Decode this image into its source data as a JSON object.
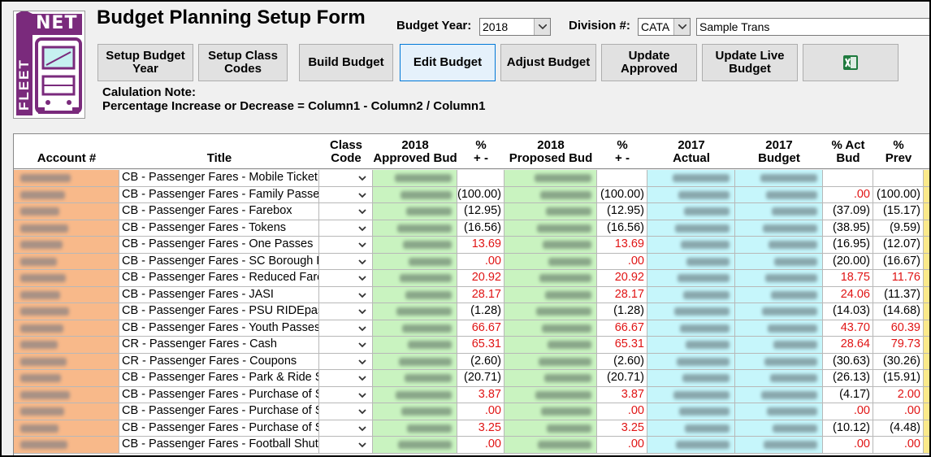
{
  "window": {
    "title": "Budget Planning Setup Form",
    "budget_year_label": "Budget Year:",
    "budget_year_value": "2018",
    "division_label": "Division #:",
    "division_value": "CATA",
    "division_name": "Sample Trans"
  },
  "logo": {
    "top_text": "NET",
    "side_text": "FLEET"
  },
  "toolbar": {
    "setup_budget_year": "Setup Budget Year",
    "setup_class_codes": "Setup Class Codes",
    "build_budget": "Build Budget",
    "edit_budget": "Edit Budget",
    "adjust_budget": "Adjust Budget",
    "update_approved": "Update Approved",
    "update_live_budget": "Update Live Budget",
    "excel_icon": "excel-icon"
  },
  "note": {
    "line1": "Calulation Note:",
    "line2": "Percentage Increase or Decrease =  Column1 - Column2 / Column1"
  },
  "columns": {
    "account": "Account #",
    "title": "Title",
    "class_code": "Class\nCode",
    "approved": "2018\nApproved Bud",
    "pct1": "%\n+ -",
    "proposed": "2018\nProposed Bud",
    "pct2": "%\n+ -",
    "actual": "2017\nActual",
    "budget": "2017\nBudget",
    "pct_act": "% Act\nBud",
    "pct_prev": "%\nPrev"
  },
  "colors": {
    "account_bg": "#f8b98a",
    "approved_bg": "#c9f3c0",
    "actual_bg": "#c6f6fb",
    "negative_text": "#000000",
    "positive_text": "#e01414"
  },
  "rows": [
    {
      "title": "CB - Passenger Fares - Mobile Ticketing",
      "pct1": "",
      "pct2": "",
      "pct_act": "",
      "pct_prev": ""
    },
    {
      "title": "CB - Passenger Fares - Family Passes",
      "pct1": "(100.00)",
      "pct2": "(100.00)",
      "pct_act": ".00",
      "pct_prev": "(100.00)"
    },
    {
      "title": "CB - Passenger Fares - Farebox",
      "pct1": "(12.95)",
      "pct2": "(12.95)",
      "pct_act": "(37.09)",
      "pct_prev": "(15.17)"
    },
    {
      "title": "CB - Passenger Fares - Tokens",
      "pct1": "(16.56)",
      "pct2": "(16.56)",
      "pct_act": "(38.95)",
      "pct_prev": "(9.59)"
    },
    {
      "title": "CB - Passenger Fares - One Passes",
      "pct1": "13.69",
      "pct2": "13.69",
      "pct_act": "(16.95)",
      "pct_prev": "(12.07)"
    },
    {
      "title": "CB - Passenger Fares - SC Borough Pas",
      "pct1": ".00",
      "pct2": ".00",
      "pct_act": "(20.00)",
      "pct_prev": "(16.67)"
    },
    {
      "title": "CB - Passenger Fares - Reduced Fare",
      "pct1": "20.92",
      "pct2": "20.92",
      "pct_act": "18.75",
      "pct_prev": "11.76"
    },
    {
      "title": "CB - Passenger Fares - JASI",
      "pct1": "28.17",
      "pct2": "28.17",
      "pct_act": "24.06",
      "pct_prev": "(11.37)"
    },
    {
      "title": "CB - Passenger Fares - PSU RIDEpass",
      "pct1": "(1.28)",
      "pct2": "(1.28)",
      "pct_act": "(14.03)",
      "pct_prev": "(14.68)"
    },
    {
      "title": "CB - Passenger Fares - Youth Passes",
      "pct1": "66.67",
      "pct2": "66.67",
      "pct_act": "43.70",
      "pct_prev": "60.39"
    },
    {
      "title": "CR - Passenger Fares - Cash",
      "pct1": "65.31",
      "pct2": "65.31",
      "pct_act": "28.64",
      "pct_prev": "79.73"
    },
    {
      "title": "CR - Passenger Fares - Coupons",
      "pct1": "(2.60)",
      "pct2": "(2.60)",
      "pct_act": "(30.63)",
      "pct_prev": "(30.26)"
    },
    {
      "title": "CB - Passenger Fares - Park & Ride Sub",
      "pct1": "(20.71)",
      "pct2": "(20.71)",
      "pct_act": "(26.13)",
      "pct_prev": "(15.91)"
    },
    {
      "title": "CB - Passenger Fares - Purchase of Ser",
      "pct1": "3.87",
      "pct2": "3.87",
      "pct_act": "(4.17)",
      "pct_prev": "2.00"
    },
    {
      "title": "CB - Passenger Fares - Purchase of Ser",
      "pct1": ".00",
      "pct2": ".00",
      "pct_act": ".00",
      "pct_prev": ".00"
    },
    {
      "title": "CB - Passenger Fares - Purchase of Ser",
      "pct1": "3.25",
      "pct2": "3.25",
      "pct_act": "(10.12)",
      "pct_prev": "(4.48)"
    },
    {
      "title": "CB - Passenger Fares - Football Shuttle",
      "pct1": ".00",
      "pct2": ".00",
      "pct_act": ".00",
      "pct_prev": ".00"
    }
  ]
}
